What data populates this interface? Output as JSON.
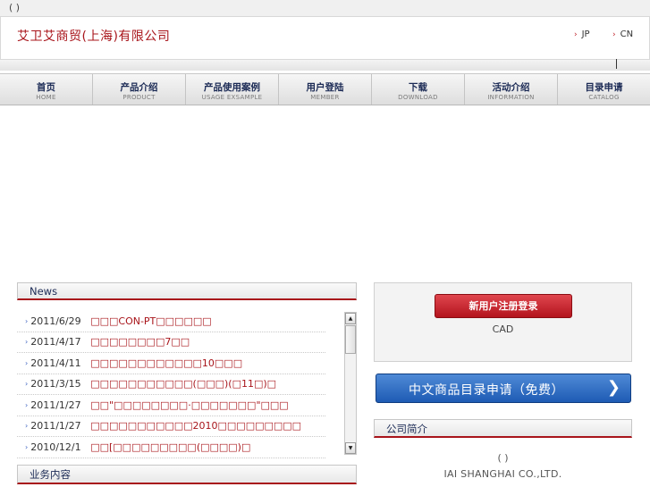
{
  "topbar": {
    "text": "(        )"
  },
  "header": {
    "company_name": "艾卫艾商贸(上海)有限公司",
    "languages": [
      {
        "arrow": "›",
        "label": "JP"
      },
      {
        "arrow": "›",
        "label": "CN"
      }
    ]
  },
  "nav": {
    "items": [
      {
        "zh": "首页",
        "en": "HOME"
      },
      {
        "zh": "产品介绍",
        "en": "PRODUCT"
      },
      {
        "zh": "产品使用案例",
        "en": "USAGE EXSAMPLE"
      },
      {
        "zh": "用户登陆",
        "en": "MEMBER"
      },
      {
        "zh": "下载",
        "en": "DOWNLOAD"
      },
      {
        "zh": "活动介绍",
        "en": "INFORMATION"
      },
      {
        "zh": "目录申请",
        "en": "CATALOG"
      }
    ]
  },
  "news": {
    "heading": "News",
    "bullet": "›",
    "items": [
      {
        "date": "2011/6/29",
        "title": "□□□CON-PT□□□□□□"
      },
      {
        "date": "2011/4/17",
        "title": "□□□□□□□□7□□"
      },
      {
        "date": "2011/4/11",
        "title": "□□□□□□□□□□□□10□□□"
      },
      {
        "date": "2011/3/15",
        "title": "□□□□□□□□□□□(□□□)(□11□)□"
      },
      {
        "date": "2011/1/27",
        "title": "□□\"□□□□□□□□·□□□□□□□\"□□□"
      },
      {
        "date": "2011/1/27",
        "title": "□□□□□□□□□□□2010□□□□□□□□□"
      },
      {
        "date": "2010/12/1",
        "title": "□□[□□□□□□□□□(□□□□)□"
      }
    ],
    "scroll_up": "▲",
    "scroll_down": "▼"
  },
  "business": {
    "heading": "业务内容"
  },
  "register": {
    "button_label": "新用户注册登录",
    "note": "CAD"
  },
  "catalog_button": {
    "label": "中文商品目录申请（免费）",
    "arrow": "❯"
  },
  "about": {
    "heading": "公司简介",
    "line1": "(  )",
    "line2": "IAI  SHANGHAI CO.,LTD."
  }
}
